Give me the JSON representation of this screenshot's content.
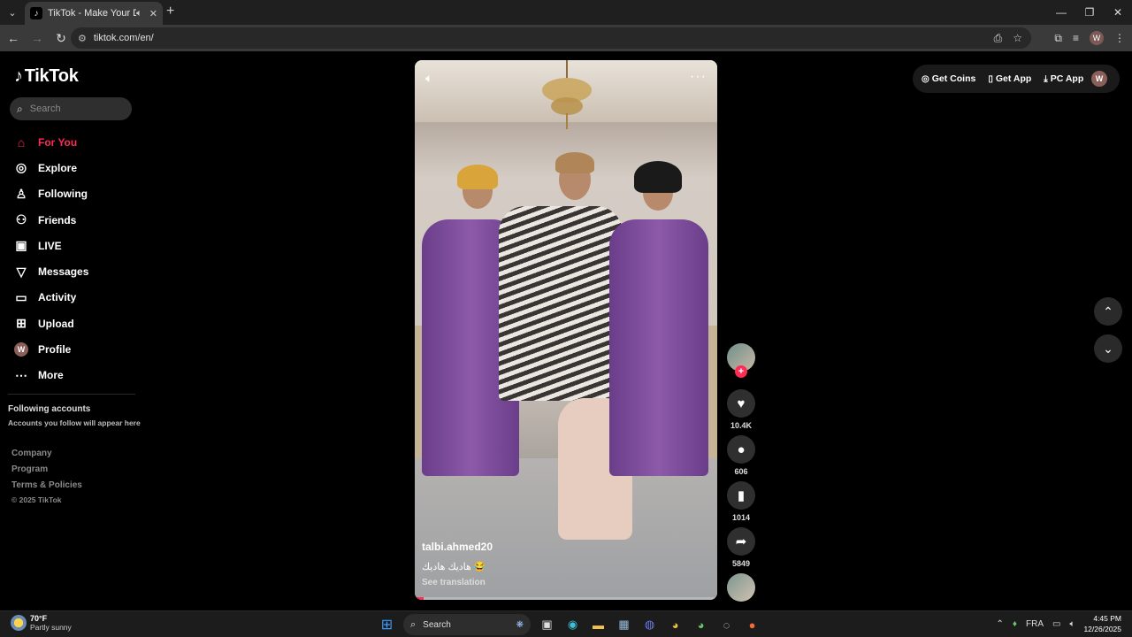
{
  "browser": {
    "tab_title": "TikTok - Make Your Day",
    "url": "tiktok.com/en/",
    "profile_initial": "W"
  },
  "tiktok": {
    "logo": "TikTok",
    "search_placeholder": "Search",
    "nav": [
      {
        "label": "For You",
        "icon": "home-icon",
        "active": true
      },
      {
        "label": "Explore",
        "icon": "compass-icon"
      },
      {
        "label": "Following",
        "icon": "person-icon"
      },
      {
        "label": "Friends",
        "icon": "friends-icon"
      },
      {
        "label": "LIVE",
        "icon": "live-icon"
      },
      {
        "label": "Messages",
        "icon": "messages-icon"
      },
      {
        "label": "Activity",
        "icon": "activity-icon"
      },
      {
        "label": "Upload",
        "icon": "upload-icon"
      },
      {
        "label": "Profile",
        "icon": "avatar"
      },
      {
        "label": "More",
        "icon": "more-icon"
      }
    ],
    "profile_initial": "W",
    "following_title": "Following accounts",
    "following_sub": "Accounts you follow will appear here",
    "footer": [
      "Company",
      "Program",
      "Terms & Policies"
    ],
    "copyright": "© 2025 TikTok",
    "top_actions": [
      "Get Coins",
      "Get App",
      "PC App"
    ],
    "video": {
      "username": "talbi.ahmed20",
      "caption": "هاديك هاديك 😂",
      "see_translation": "See translation",
      "progress": 0.03
    },
    "actions": {
      "likes": "10.4K",
      "comments": "606",
      "saves": "1014",
      "shares": "5849"
    }
  },
  "taskbar": {
    "temp": "70°F",
    "weather": "Partly sunny",
    "search": "Search",
    "lang": "FRA",
    "time": "4:45 PM",
    "date": "12/26/2025"
  }
}
